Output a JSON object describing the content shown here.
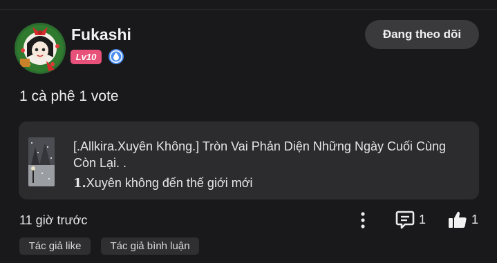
{
  "author": {
    "name": "Fukashi",
    "level_label": "Lv10",
    "level_color": "#e8527a",
    "avatar_icon": "christmas-wreath-avatar",
    "verify_icon": "blue-water-drop-badge"
  },
  "follow_button": {
    "label": "Đang theo dõi"
  },
  "comment": {
    "text": "1 cà phê 1 vote"
  },
  "story": {
    "title": "[.Allkira.Xuyên Không.] Tròn Vai Phản Diện Những Ngày Cuối Cùng Còn Lại. .",
    "chapter_number": "1.",
    "chapter_title": "Xuyên không đến thế giới mới",
    "cover_icon": "snowy-night-cover"
  },
  "meta": {
    "time": "11 giờ trước",
    "reply_count": "1",
    "like_count": "1"
  },
  "chips": {
    "author_like": "Tác giả like",
    "author_comment": "Tác giả bình luận"
  },
  "colors": {
    "background": "#19191b",
    "card": "#2c2c2f",
    "button": "#3a3a3d",
    "accent_blue": "#4a8ef0"
  }
}
